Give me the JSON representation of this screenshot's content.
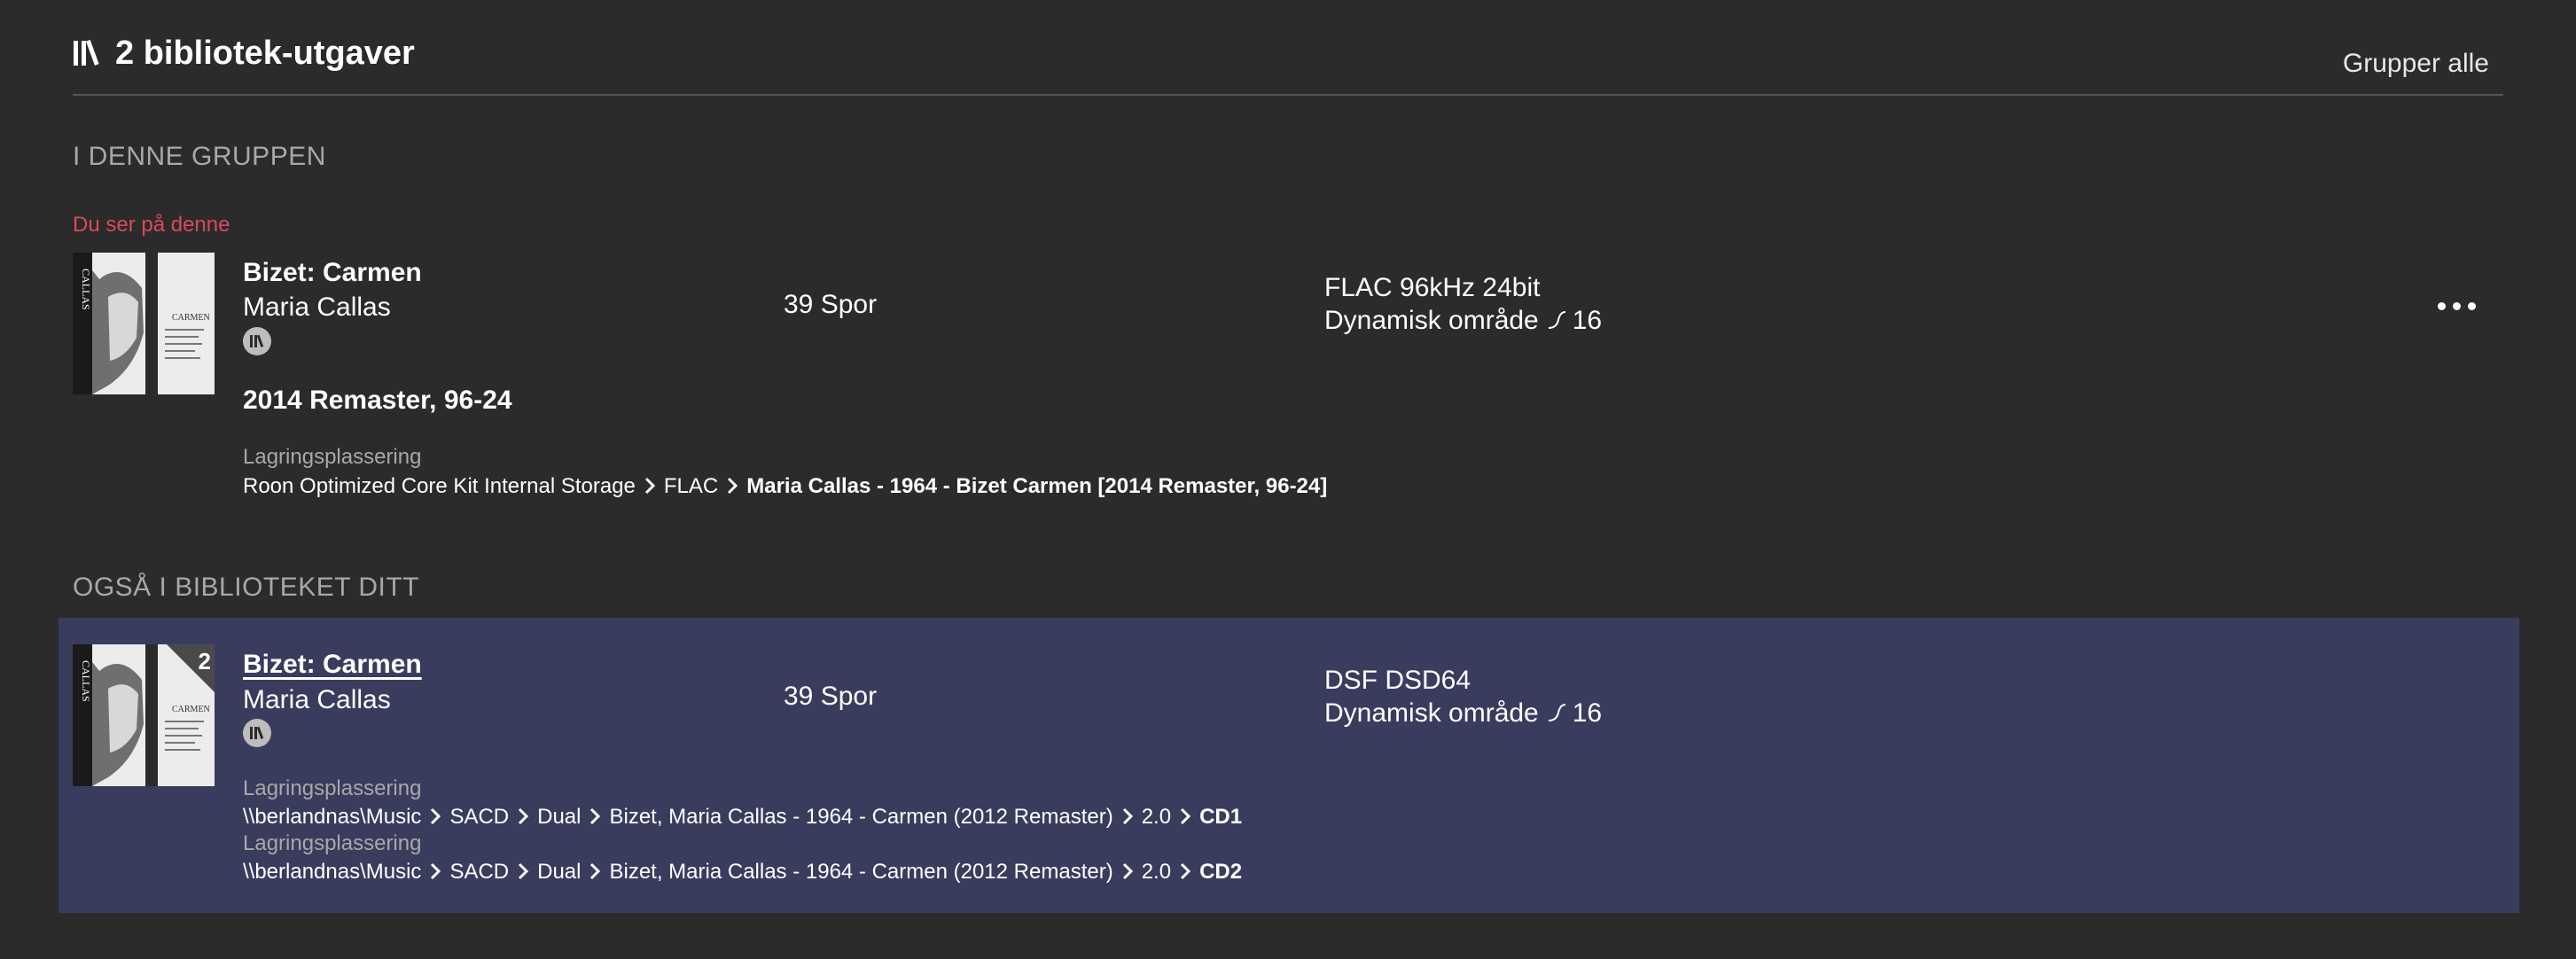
{
  "header": {
    "title": "2 bibliotek-utgaver",
    "group_all": "Grupper alle"
  },
  "sections": {
    "in_group": "I DENNE GRUPPEN",
    "also_in_library": "OGSÅ I BIBLIOTEKET DITT"
  },
  "current": {
    "viewing_label": "Du ser på denne",
    "title": "Bizet: Carmen",
    "artist": "Maria Callas",
    "version": "2014 Remaster, 96-24",
    "tracks": "39 Spor",
    "format": "FLAC 96kHz 24bit",
    "dynamic_range_label": "Dynamisk område",
    "dynamic_range_value": "16",
    "storage_label": "Lagringsplassering",
    "path": [
      "Roon Optimized Core Kit Internal Storage",
      "FLAC",
      "Maria Callas - 1964 - Bizet Carmen [2014 Remaster, 96-24]"
    ]
  },
  "other": {
    "disc_count": "2",
    "title": "Bizet: Carmen",
    "artist": "Maria Callas",
    "tracks": "39 Spor",
    "format": "DSF DSD64",
    "dynamic_range_label": "Dynamisk område",
    "dynamic_range_value": "16",
    "storage_label_1": "Lagringsplassering",
    "path_1": [
      "\\\\berlandnas\\Music",
      "SACD",
      "Dual",
      "Bizet, Maria Callas - 1964 - Carmen (2012 Remaster)",
      "2.0",
      "CD1"
    ],
    "storage_label_2": "Lagringsplassering",
    "path_2": [
      "\\\\berlandnas\\Music",
      "SACD",
      "Dual",
      "Bizet, Maria Callas - 1964 - Carmen (2012 Remaster)",
      "2.0",
      "CD2"
    ]
  },
  "icons": {
    "header": "library-icon",
    "badge": "library-badge-icon",
    "more": "more-options-icon",
    "chevron": "chevron-right-icon",
    "dynamic_range": "dynamic-range-icon"
  },
  "colors": {
    "background": "#2b2b2b",
    "highlight_row": "#3a3c5e",
    "accent": "#d94a5c",
    "muted": "#a8a8a8"
  }
}
